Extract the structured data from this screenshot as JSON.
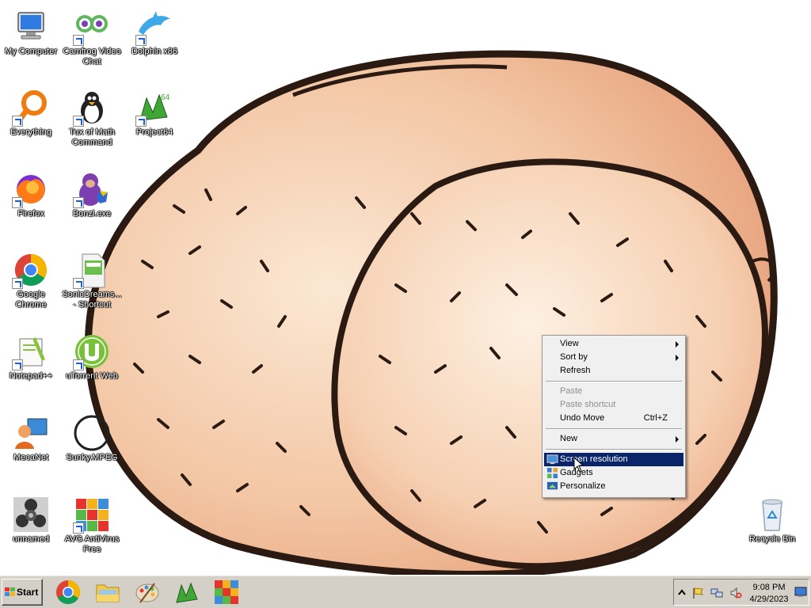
{
  "desktop": {
    "icons": [
      {
        "label": "My Computer",
        "icon": "computer-icon"
      },
      {
        "label": "Camfrog Video Chat",
        "icon": "camfrog-icon"
      },
      {
        "label": "Dolphin x86",
        "icon": "dolphin-icon"
      },
      {
        "label": "Everything",
        "icon": "everything-search-icon"
      },
      {
        "label": "Tux of Math Command",
        "icon": "tux-penguin-icon"
      },
      {
        "label": "Project64",
        "icon": "project64-icon"
      },
      {
        "label": "Firefox",
        "icon": "firefox-icon"
      },
      {
        "label": "Bonzi.exe",
        "icon": "bonzi-icon"
      },
      {
        "label": "Google Chrome",
        "icon": "chrome-icon"
      },
      {
        "label": "SonicDreams... - Shortcut",
        "icon": "sonic-document-icon"
      },
      {
        "label": "Notepad++",
        "icon": "notepadpp-icon"
      },
      {
        "label": "uTorrent Web",
        "icon": "utorrent-icon"
      },
      {
        "label": "MecaNet",
        "icon": "mecanet-icon"
      },
      {
        "label": "Sunky.MPEG",
        "icon": "sunky-circle-icon"
      },
      {
        "label": "unnamed",
        "icon": "fidget-spinner-icon"
      },
      {
        "label": "AVG AntiVirus Free",
        "icon": "avg-icon"
      },
      {
        "label": "Recycle Bin",
        "icon": "recycle-bin-icon"
      }
    ]
  },
  "context_menu": {
    "items": [
      {
        "label": "View",
        "submenu": true
      },
      {
        "label": "Sort by",
        "submenu": true
      },
      {
        "label": "Refresh"
      },
      {
        "label": "Paste",
        "disabled": true
      },
      {
        "label": "Paste shortcut",
        "disabled": true
      },
      {
        "label": "Undo Move",
        "shortcut": "Ctrl+Z"
      },
      {
        "label": "New",
        "submenu": true
      },
      {
        "label": "Screen resolution",
        "highlighted": true
      },
      {
        "label": "Gadgets"
      },
      {
        "label": "Personalize"
      }
    ]
  },
  "taskbar": {
    "start_label": "Start",
    "pinned": [
      "chrome-icon",
      "explorer-folder-icon",
      "paint-palette-icon",
      "project64-icon",
      "avg-icon"
    ],
    "tray": {
      "icons": [
        "show-hidden-chevron-icon",
        "action-center-flag-icon",
        "network-icon",
        "volume-muted-icon"
      ],
      "time": "9:08 PM",
      "date": "4/29/2023"
    }
  },
  "colors": {
    "menu_highlight": "#0a246a",
    "taskbar": "#d4d0c8",
    "wallpaper_skin": "#f2c2a0",
    "wallpaper_outline": "#2a1a12"
  }
}
